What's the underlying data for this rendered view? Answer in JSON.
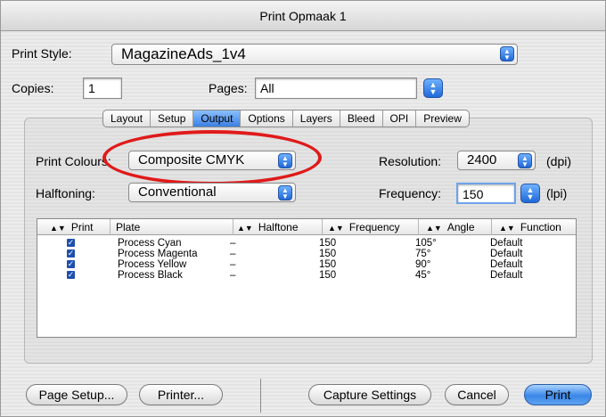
{
  "window": {
    "title": "Print Opmaak 1"
  },
  "print_style": {
    "label": "Print Style:",
    "value": "MagazineAds_1v4"
  },
  "copies": {
    "label": "Copies:",
    "value": "1"
  },
  "pages": {
    "label": "Pages:",
    "value": "All"
  },
  "tabs": [
    "Layout",
    "Setup",
    "Output",
    "Options",
    "Layers",
    "Bleed",
    "OPI",
    "Preview"
  ],
  "active_tab": "Output",
  "print_colours": {
    "label": "Print Colours:",
    "value": "Composite CMYK"
  },
  "halftoning": {
    "label": "Halftoning:",
    "value": "Conventional"
  },
  "resolution": {
    "label": "Resolution:",
    "value": "2400",
    "unit": "(dpi)"
  },
  "frequency": {
    "label": "Frequency:",
    "value": "150",
    "unit": "(lpi)"
  },
  "table": {
    "columns": [
      "Print",
      "Plate",
      "Halftone",
      "Frequency",
      "Angle",
      "Function"
    ],
    "rows": [
      {
        "plate": "Process Cyan",
        "halftone": "–",
        "frequency": "150",
        "angle": "105°",
        "function": "Default"
      },
      {
        "plate": "Process Magenta",
        "halftone": "–",
        "frequency": "150",
        "angle": "75°",
        "function": "Default"
      },
      {
        "plate": "Process Yellow",
        "halftone": "–",
        "frequency": "150",
        "angle": "90°",
        "function": "Default"
      },
      {
        "plate": "Process Black",
        "halftone": "–",
        "frequency": "150",
        "angle": "45°",
        "function": "Default"
      }
    ]
  },
  "buttons": {
    "page_setup": "Page Setup...",
    "printer": "Printer...",
    "capture_settings": "Capture Settings",
    "cancel": "Cancel",
    "print": "Print"
  },
  "colors": {
    "accent": "#3a87e8",
    "annotation": "#e01a1a"
  }
}
